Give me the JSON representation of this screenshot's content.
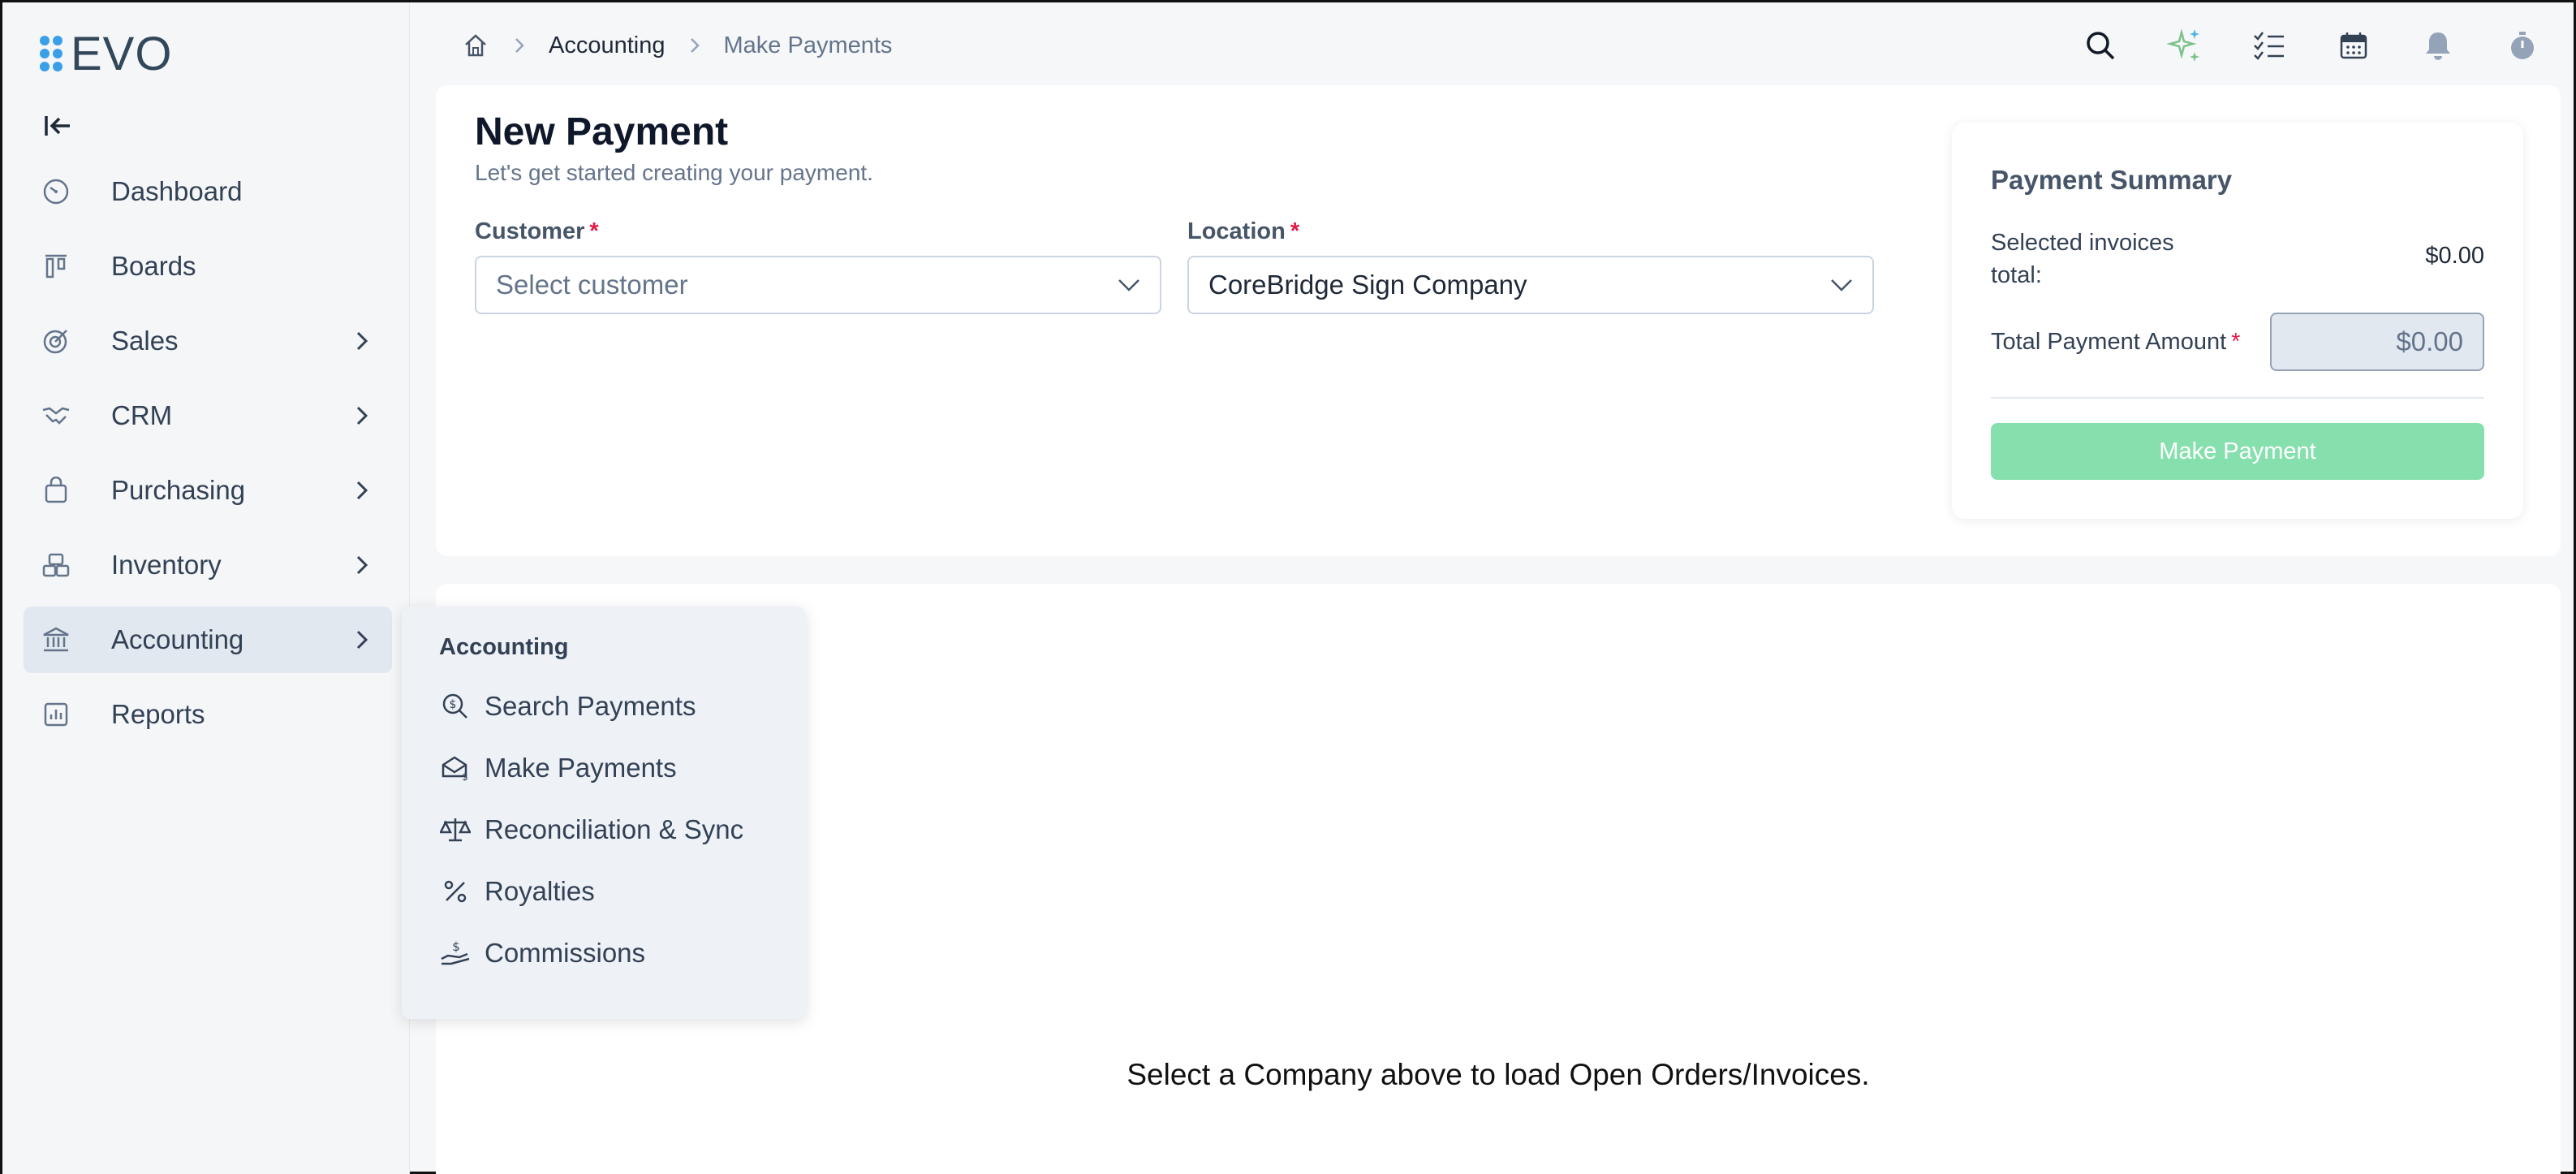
{
  "app": {
    "logo_text": "EVO"
  },
  "sidebar": {
    "items": [
      {
        "label": "Dashboard",
        "icon": "dashboard-icon",
        "has_submenu": false
      },
      {
        "label": "Boards",
        "icon": "boards-icon",
        "has_submenu": false
      },
      {
        "label": "Sales",
        "icon": "sales-icon",
        "has_submenu": true
      },
      {
        "label": "CRM",
        "icon": "handshake-icon",
        "has_submenu": true
      },
      {
        "label": "Purchasing",
        "icon": "bag-icon",
        "has_submenu": true
      },
      {
        "label": "Inventory",
        "icon": "boxes-icon",
        "has_submenu": true
      },
      {
        "label": "Accounting",
        "icon": "bank-icon",
        "has_submenu": true,
        "active": true
      },
      {
        "label": "Reports",
        "icon": "chart-icon",
        "has_submenu": false
      }
    ]
  },
  "flyout": {
    "title": "Accounting",
    "items": [
      {
        "label": "Search Payments",
        "icon": "search-dollar-icon"
      },
      {
        "label": "Make Payments",
        "icon": "envelope-dollar-icon"
      },
      {
        "label": "Reconciliation & Sync",
        "icon": "scale-icon"
      },
      {
        "label": "Royalties",
        "icon": "percent-icon"
      },
      {
        "label": "Commissions",
        "icon": "hand-coin-icon"
      }
    ]
  },
  "breadcrumb": {
    "section": "Accounting",
    "current": "Make Payments"
  },
  "page": {
    "title": "New Payment",
    "subtitle": "Let's get started creating your payment.",
    "customer": {
      "label": "Customer",
      "required": "*",
      "placeholder": "Select customer"
    },
    "location": {
      "label": "Location",
      "required": "*",
      "value": "CoreBridge Sign Company"
    }
  },
  "summary": {
    "title": "Payment Summary",
    "selected_label_line1": "Selected invoices",
    "selected_label_line2": "total:",
    "selected_total": "$0.00",
    "amount_label": "Total Payment Amount",
    "amount_required": "*",
    "amount_value": "$0.00",
    "button_label": "Make Payment"
  },
  "lower": {
    "empty_message": "Select a Company above to load Open Orders/Invoices."
  },
  "colors": {
    "accent_blue": "#3b9fe8",
    "pay_button": "#86e0ae",
    "required": "#e11d48",
    "sparkle": "#7cc28a"
  }
}
